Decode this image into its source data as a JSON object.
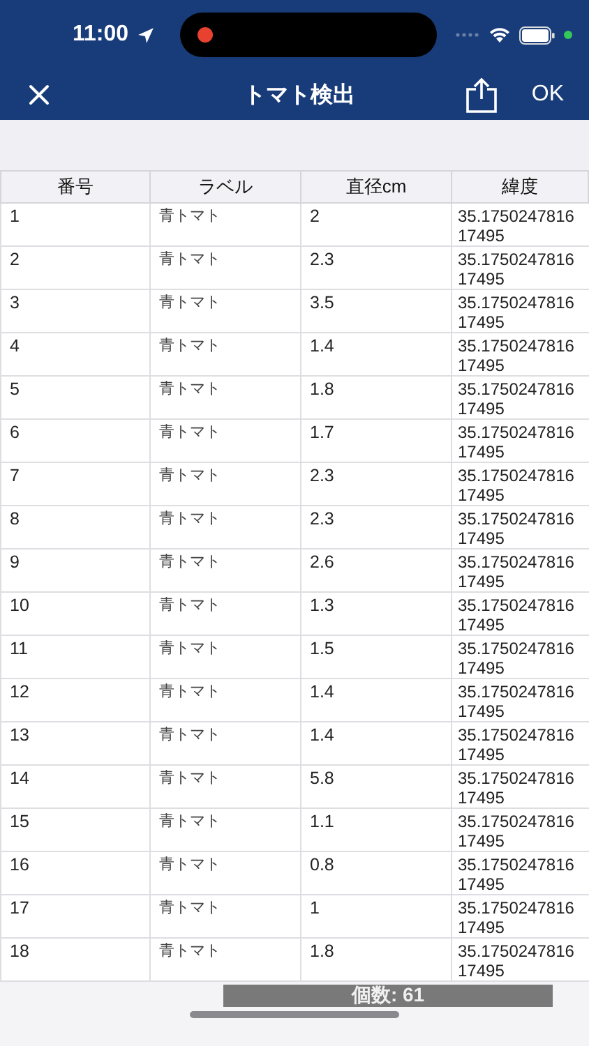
{
  "status_bar": {
    "time": "11:00"
  },
  "nav": {
    "title": "トマト検出",
    "action": "OK"
  },
  "table": {
    "columns": [
      "番号",
      "ラベル",
      "直径cm",
      "緯度"
    ],
    "rows": [
      [
        "1",
        "青トマト",
        "2",
        "35.175024781617495"
      ],
      [
        "2",
        "青トマト",
        "2.3",
        "35.175024781617495"
      ],
      [
        "3",
        "青トマト",
        "3.5",
        "35.175024781617495"
      ],
      [
        "4",
        "青トマト",
        "1.4",
        "35.175024781617495"
      ],
      [
        "5",
        "青トマト",
        "1.8",
        "35.175024781617495"
      ],
      [
        "6",
        "青トマト",
        "1.7",
        "35.175024781617495"
      ],
      [
        "7",
        "青トマト",
        "2.3",
        "35.175024781617495"
      ],
      [
        "8",
        "青トマト",
        "2.3",
        "35.175024781617495"
      ],
      [
        "9",
        "青トマト",
        "2.6",
        "35.175024781617495"
      ],
      [
        "10",
        "青トマト",
        "1.3",
        "35.175024781617495"
      ],
      [
        "11",
        "青トマト",
        "1.5",
        "35.175024781617495"
      ],
      [
        "12",
        "青トマト",
        "1.4",
        "35.175024781617495"
      ],
      [
        "13",
        "青トマト",
        "1.4",
        "35.175024781617495"
      ],
      [
        "14",
        "青トマト",
        "5.8",
        "35.175024781617495"
      ],
      [
        "15",
        "青トマト",
        "1.1",
        "35.175024781617495"
      ],
      [
        "16",
        "青トマト",
        "0.8",
        "35.175024781617495"
      ],
      [
        "17",
        "青トマト",
        "1",
        "35.175024781617495"
      ],
      [
        "18",
        "青トマト",
        "1.8",
        "35.175024781617495"
      ]
    ]
  },
  "count_toast": "個数: 61"
}
